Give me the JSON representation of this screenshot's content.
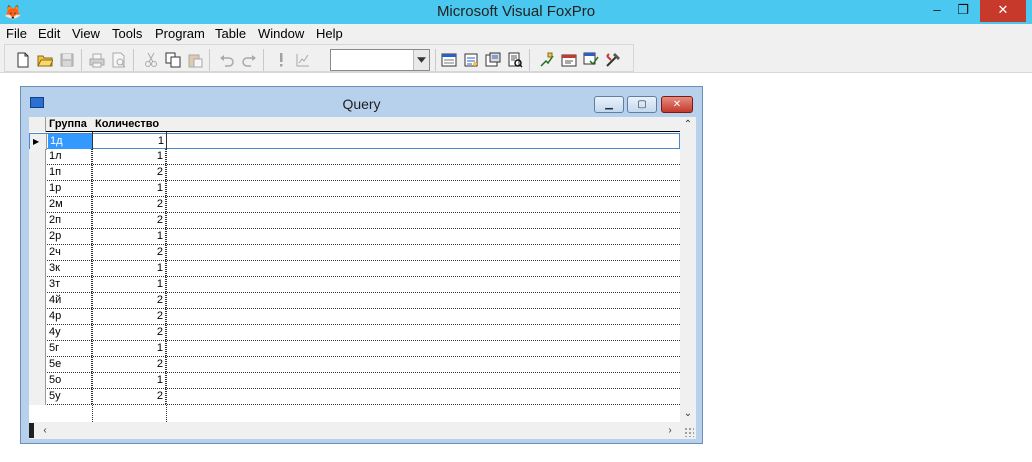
{
  "app": {
    "title": "Microsoft Visual FoxPro",
    "icon": "fox-icon",
    "window_buttons": {
      "minimize": "–",
      "restore": "❐",
      "close": "✕"
    }
  },
  "menu": [
    "File",
    "Edit",
    "View",
    "Tools",
    "Program",
    "Table",
    "Window",
    "Help"
  ],
  "toolbar": {
    "buttons": [
      "new-file",
      "open",
      "save",
      "print",
      "print-preview",
      "cut",
      "copy",
      "paste",
      "undo",
      "redo",
      "run",
      "modify-form",
      "data-session",
      "properties",
      "code-window",
      "report",
      "form-designer",
      "class-browser",
      "object-browser",
      "builder"
    ],
    "combo_value": ""
  },
  "query_window": {
    "title": "Query",
    "columns": [
      "Группа",
      "Количество"
    ],
    "rows": [
      {
        "group": "1д",
        "count": "1"
      },
      {
        "group": "1л",
        "count": "1"
      },
      {
        "group": "1п",
        "count": "2"
      },
      {
        "group": "1р",
        "count": "1"
      },
      {
        "group": "2м",
        "count": "2"
      },
      {
        "group": "2п",
        "count": "2"
      },
      {
        "group": "2р",
        "count": "1"
      },
      {
        "group": "2ч",
        "count": "2"
      },
      {
        "group": "3к",
        "count": "1"
      },
      {
        "group": "3т",
        "count": "1"
      },
      {
        "group": "4й",
        "count": "2"
      },
      {
        "group": "4р",
        "count": "2"
      },
      {
        "group": "4у",
        "count": "2"
      },
      {
        "group": "5г",
        "count": "1"
      },
      {
        "group": "5е",
        "count": "2"
      },
      {
        "group": "5о",
        "count": "1"
      },
      {
        "group": "5у",
        "count": "2"
      }
    ],
    "active_row": 0,
    "colors": {
      "selection": "#3399ff",
      "title_bar": "#b7d1ec"
    }
  }
}
